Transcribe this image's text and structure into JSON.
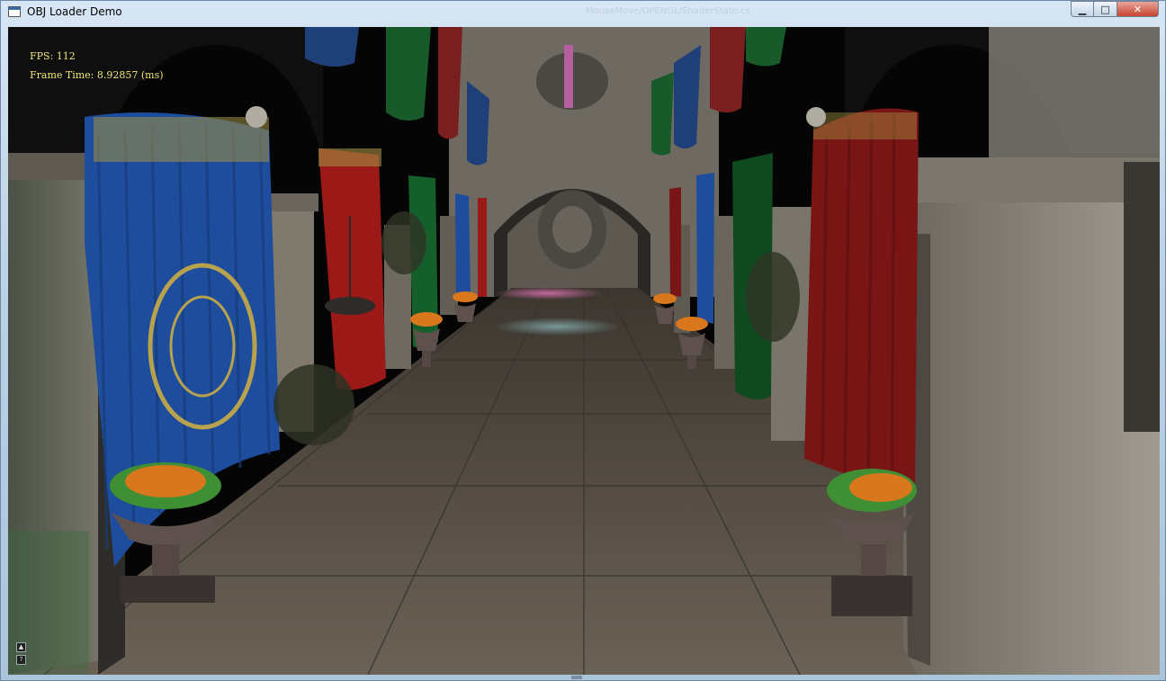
{
  "window": {
    "title": "OBJ Loader Demo",
    "ghost_title": "MouseMove/OPENGL/ShaderState.cs",
    "minimize_glyph": "▁",
    "maximize_glyph": "□",
    "close_glyph": "✕"
  },
  "hud": {
    "fps": "FPS: 112",
    "frame_time": "Frame Time: 8.92857 (ms)",
    "color": "#f4e97a"
  },
  "scene": {
    "description_icon": "sponza-atrium-scene",
    "curtain_colors": [
      "#1d4d9c",
      "#9b1a17",
      "#15602a"
    ],
    "floor_color": "#5a5045",
    "stone_color": "#8a8478"
  },
  "corner_icons": {
    "up_glyph": "▲",
    "help_glyph": "?"
  }
}
